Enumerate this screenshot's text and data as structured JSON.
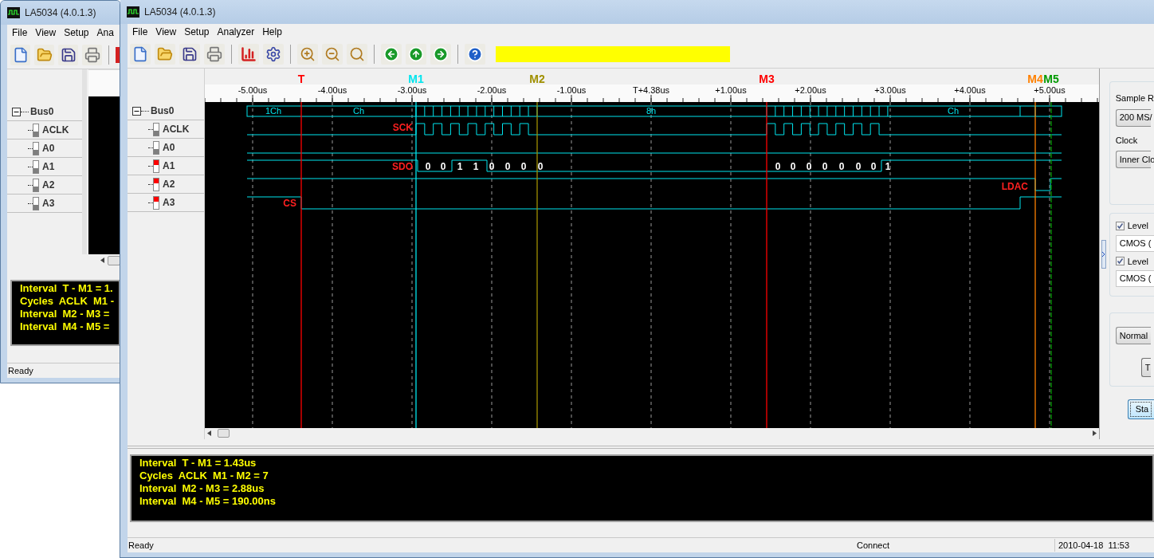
{
  "back_window": {
    "title": "LA5034 (4.0.1.3)",
    "menu": [
      "File",
      "View",
      "Setup",
      "Ana"
    ],
    "tree": {
      "bus": "Bus0",
      "expanded": true,
      "channels": [
        {
          "name": "ACLK",
          "high": false
        },
        {
          "name": "A0",
          "high": false
        },
        {
          "name": "A1",
          "high": false
        },
        {
          "name": "A2",
          "high": false
        },
        {
          "name": "A3",
          "high": false
        }
      ]
    },
    "measurements": [
      "Interval  T - M1 = 1.",
      "Cycles  ACLK  M1 -",
      "Interval  M2 - M3 =",
      "Interval  M4 - M5 ="
    ],
    "status": "Ready"
  },
  "window": {
    "title": "LA5034 (4.0.1.3)",
    "menu": [
      "File",
      "View",
      "Setup",
      "Analyzer",
      "Help"
    ],
    "tree": {
      "bus": "Bus0",
      "expanded": true,
      "channels": [
        {
          "name": "ACLK",
          "high": false
        },
        {
          "name": "A0",
          "high": false
        },
        {
          "name": "A1",
          "high": true
        },
        {
          "name": "A2",
          "high": true
        },
        {
          "name": "A3",
          "high": true
        }
      ]
    },
    "waveform": {
      "markers": [
        {
          "label": "T",
          "color": "#ff0000"
        },
        {
          "label": "M1",
          "color": "#00e5ee"
        },
        {
          "label": "M2",
          "color": "#a09000"
        },
        {
          "label": "M3",
          "color": "#ff0000"
        },
        {
          "label": "M4",
          "color": "#ff8000"
        },
        {
          "label": "M5",
          "color": "#009a00"
        }
      ],
      "ticks": [
        "-5.00us",
        "-4.00us",
        "-3.00us",
        "-2.00us",
        "-1.00us",
        "T+4.38us",
        "+1.00us",
        "+2.00us",
        "+3.00us",
        "+4.00us",
        "+5.00us"
      ],
      "bus_values": [
        "1Ch",
        "Ch",
        "8h",
        "Ch"
      ],
      "signal_labels": [
        "SCK",
        "SDO",
        "LDAC",
        "CS"
      ],
      "bits": [
        [
          "0",
          "0",
          "1",
          "1",
          "0",
          "0",
          "0",
          "0"
        ],
        [
          "0",
          "0",
          "0",
          "0",
          "0",
          "0",
          "0",
          "1"
        ]
      ]
    },
    "measurements": [
      "Interval  T - M1 = 1.43us",
      "Cycles  ACLK  M1 - M2 = 7",
      "Interval  M2 - M3 = 2.88us",
      "Interval  M4 - M5 = 190.00ns"
    ],
    "settings": {
      "sample_rate_label": "Sample R",
      "sample_rate": "200 MS/",
      "clock_label": "Clock",
      "clock": "Inner Clo",
      "levels": [
        {
          "label": "Level",
          "checked": true,
          "value": "CMOS ("
        },
        {
          "label": "Level",
          "checked": true,
          "value": "CMOS ("
        }
      ],
      "mode": "Normal",
      "buttons": [
        "T",
        "Sta"
      ]
    },
    "status_bar": {
      "message": "Ready",
      "connection": "Connect",
      "datetime": "2010-04-18  11:53"
    }
  }
}
